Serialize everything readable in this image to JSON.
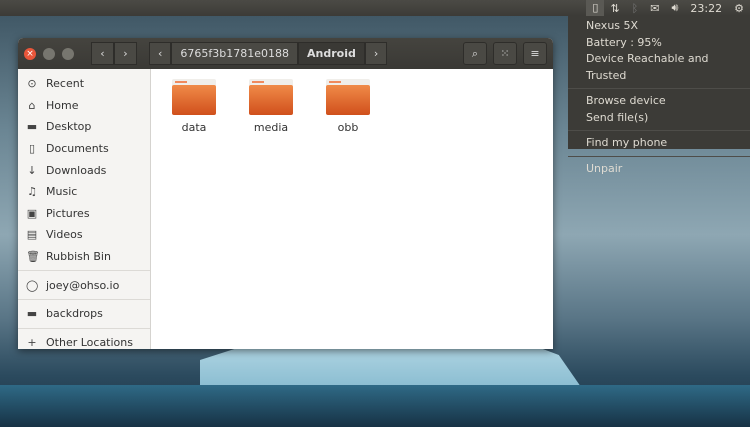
{
  "panel": {
    "clock": "23:22"
  },
  "indicator_menu": {
    "device": "Nexus 5X",
    "battery": "Battery : 95%",
    "status": "Device Reachable and Trusted",
    "browse": "Browse device",
    "send": "Send file(s)",
    "find": "Find my phone",
    "unpair": "Unpair"
  },
  "window": {
    "breadcrumbs": [
      "6765f3b1781e0188",
      "Android"
    ]
  },
  "sidebar": {
    "items": [
      {
        "label": "Recent",
        "icon": "⊙"
      },
      {
        "label": "Home",
        "icon": "⌂"
      },
      {
        "label": "Desktop",
        "icon": "▬"
      },
      {
        "label": "Documents",
        "icon": "▯"
      },
      {
        "label": "Downloads",
        "icon": "↓"
      },
      {
        "label": "Music",
        "icon": "♫"
      },
      {
        "label": "Pictures",
        "icon": "▣"
      },
      {
        "label": "Videos",
        "icon": "▤"
      },
      {
        "label": "Rubbish Bin",
        "icon": "🗑"
      }
    ],
    "account": {
      "label": "joey@ohso.io",
      "icon": "◯"
    },
    "bookmark": {
      "label": "backdrops",
      "icon": "▬"
    },
    "other": {
      "label": "Other Locations",
      "icon": "+"
    }
  },
  "files": [
    {
      "name": "data"
    },
    {
      "name": "media"
    },
    {
      "name": "obb"
    }
  ]
}
